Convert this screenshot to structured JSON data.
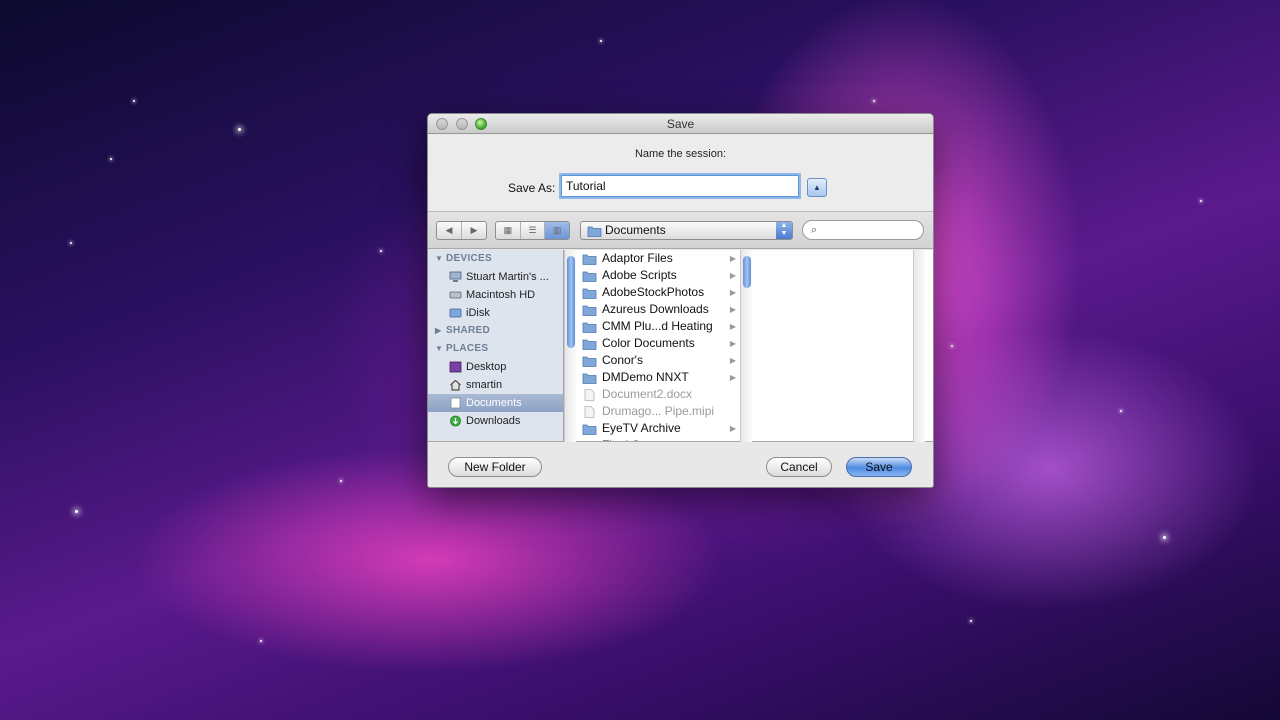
{
  "dialog": {
    "title": "Save",
    "prompt": "Name the session:",
    "save_as_label": "Save As:",
    "save_as_value": "Tutorial",
    "path_popup": "Documents",
    "search_placeholder": ""
  },
  "sidebar": {
    "sections": [
      {
        "label": "DEVICES",
        "items": [
          {
            "label": "Stuart Martin's ...",
            "icon": "computer-icon"
          },
          {
            "label": "Macintosh HD",
            "icon": "hard-drive-icon"
          },
          {
            "label": "iDisk",
            "icon": "idisk-icon"
          }
        ]
      },
      {
        "label": "SHARED",
        "items": []
      },
      {
        "label": "PLACES",
        "items": [
          {
            "label": "Desktop",
            "icon": "desktop-icon"
          },
          {
            "label": "smartin",
            "icon": "home-icon"
          },
          {
            "label": "Documents",
            "icon": "documents-icon",
            "selected": true
          },
          {
            "label": "Downloads",
            "icon": "downloads-icon"
          }
        ]
      }
    ]
  },
  "files": [
    {
      "name": "Adaptor Files",
      "type": "folder"
    },
    {
      "name": "Adobe Scripts",
      "type": "folder"
    },
    {
      "name": "AdobeStockPhotos",
      "type": "folder"
    },
    {
      "name": "Azureus Downloads",
      "type": "folder"
    },
    {
      "name": "CMM Plu...d Heating",
      "type": "folder"
    },
    {
      "name": "Color Documents",
      "type": "folder"
    },
    {
      "name": "Conor's",
      "type": "folder"
    },
    {
      "name": "DMDemo NNXT",
      "type": "folder"
    },
    {
      "name": "Document2.docx",
      "type": "file"
    },
    {
      "name": "Drumago... Pipe.mipi",
      "type": "file"
    },
    {
      "name": "EyeTV Archive",
      "type": "folder"
    },
    {
      "name": "Final Cut ...ocuments",
      "type": "folder"
    }
  ],
  "buttons": {
    "new_folder": "New Folder",
    "cancel": "Cancel",
    "save": "Save"
  }
}
